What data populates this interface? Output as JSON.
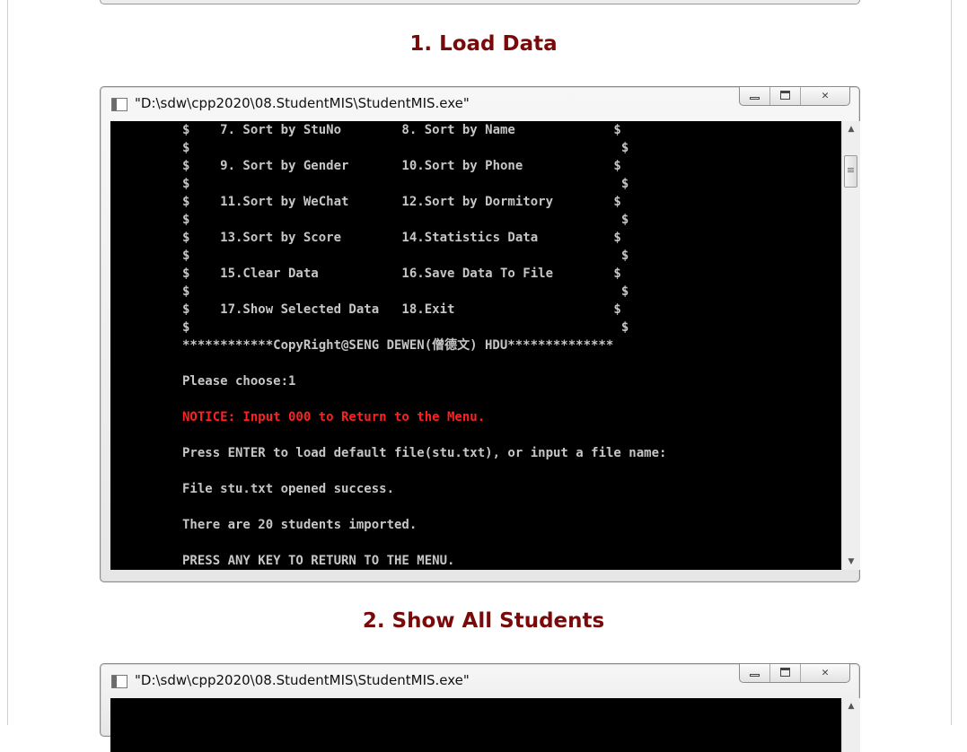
{
  "sections": [
    {
      "title": "1. Load Data"
    },
    {
      "title": "2. Show All Students"
    }
  ],
  "window1": {
    "title": "\"D:\\sdw\\cpp2020\\08.StudentMIS\\StudentMIS.exe\"",
    "console_lines": [
      {
        "text": "$    7. Sort by StuNo        8. Sort by Name             $",
        "color": "normal"
      },
      {
        "text": "$                                                         $",
        "color": "normal"
      },
      {
        "text": "$    9. Sort by Gender       10.Sort by Phone            $",
        "color": "normal"
      },
      {
        "text": "$                                                         $",
        "color": "normal"
      },
      {
        "text": "$    11.Sort by WeChat       12.Sort by Dormitory        $",
        "color": "normal"
      },
      {
        "text": "$                                                         $",
        "color": "normal"
      },
      {
        "text": "$    13.Sort by Score        14.Statistics Data          $",
        "color": "normal"
      },
      {
        "text": "$                                                         $",
        "color": "normal"
      },
      {
        "text": "$    15.Clear Data           16.Save Data To File        $",
        "color": "normal"
      },
      {
        "text": "$                                                         $",
        "color": "normal"
      },
      {
        "text": "$    17.Show Selected Data   18.Exit                     $",
        "color": "normal"
      },
      {
        "text": "$                                                         $",
        "color": "normal"
      },
      {
        "text": "************CopyRight@SENG DEWEN(僧德文) HDU**************",
        "color": "normal"
      },
      {
        "text": "",
        "color": "normal"
      },
      {
        "text": "Please choose:1",
        "color": "normal"
      },
      {
        "text": "",
        "color": "normal"
      },
      {
        "text": "NOTICE: Input 000 to Return to the Menu.",
        "color": "red"
      },
      {
        "text": "",
        "color": "normal"
      },
      {
        "text": "Press ENTER to load default file(stu.txt), or input a file name:",
        "color": "normal"
      },
      {
        "text": "",
        "color": "normal"
      },
      {
        "text": "File stu.txt opened success.",
        "color": "normal"
      },
      {
        "text": "",
        "color": "normal"
      },
      {
        "text": "There are 20 students imported.",
        "color": "normal"
      },
      {
        "text": "",
        "color": "normal"
      },
      {
        "text": "PRESS ANY KEY TO RETURN TO THE MENU.",
        "color": "normal"
      }
    ]
  },
  "window2": {
    "title": "\"D:\\sdw\\cpp2020\\08.StudentMIS\\StudentMIS.exe\""
  },
  "colors": {
    "section_title": "#7a0a0a",
    "console_bg": "#000000",
    "console_text": "#c6c6c6",
    "notice": "#ff2020"
  }
}
